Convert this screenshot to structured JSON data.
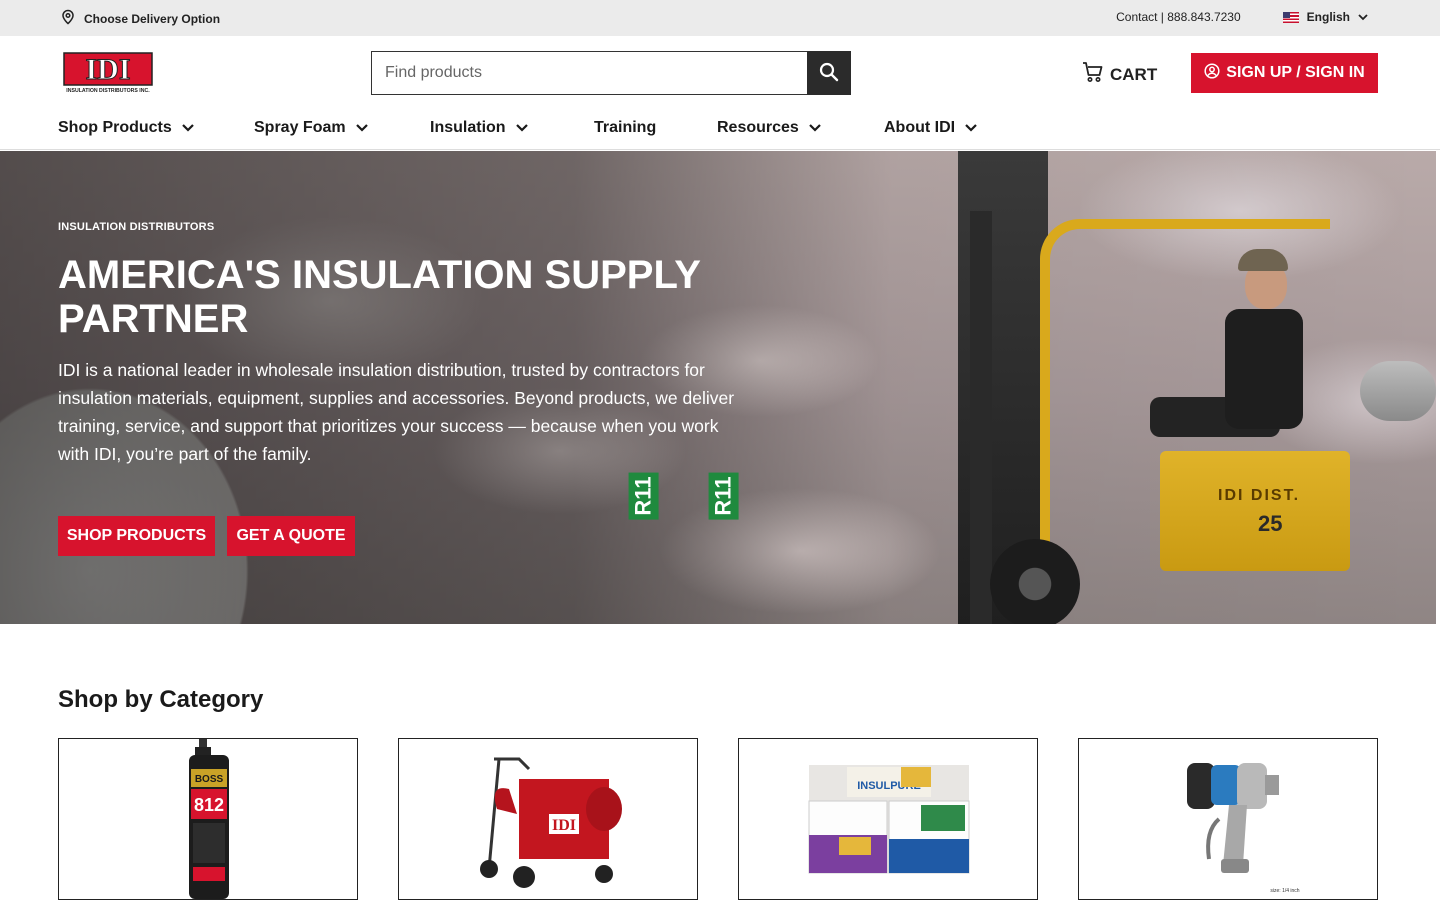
{
  "utility_bar": {
    "delivery_label": "Choose Delivery Option",
    "contact_label": "Contact | 888.843.7230",
    "language_label": "English"
  },
  "header": {
    "logo_text": "IDI",
    "logo_subtext": "INSULATION DISTRIBUTORS INC.",
    "search_placeholder": "Find products",
    "cart_label": "CART",
    "signup_label": "SIGN UP / SIGN IN"
  },
  "nav": {
    "items": [
      {
        "label": "Shop Products",
        "has_dropdown": true
      },
      {
        "label": "Spray Foam",
        "has_dropdown": true
      },
      {
        "label": "Insulation",
        "has_dropdown": true
      },
      {
        "label": "Training",
        "has_dropdown": false
      },
      {
        "label": "Resources",
        "has_dropdown": true
      },
      {
        "label": "About IDI",
        "has_dropdown": true
      }
    ]
  },
  "hero": {
    "eyebrow": "INSULATION DISTRIBUTORS",
    "title": "AMERICA'S INSULATION SUPPLY PARTNER",
    "body": "IDI is a national leader in wholesale insulation distribution, trusted by contractors for insulation materials, equipment, supplies and accessories. Beyond products, we deliver training, service, and support that prioritizes your success — because when you work with IDI, you’re part of the family.",
    "primary_cta": "SHOP PRODUCTS",
    "secondary_cta": "GET A QUOTE",
    "image_labels": {
      "forklift_text": "IDI DIST.",
      "forklift_number": "25",
      "bag_label": "R11"
    }
  },
  "categories": {
    "title": "Shop by Category",
    "items": [
      {
        "image": "spray-foam-can",
        "product_text": "812"
      },
      {
        "image": "insulation-blowing-machine",
        "product_text": "IDI"
      },
      {
        "image": "fiberglass-insulation-bags",
        "product_text": "INSULPURE"
      },
      {
        "image": "spray-gun",
        "product_text": "size: 1/4 inch"
      }
    ]
  },
  "colors": {
    "brand_red": "#d7132d",
    "dark": "#2b2b2b",
    "utility_bg": "#ebebeb",
    "forklift_yellow": "#d9a91c"
  }
}
